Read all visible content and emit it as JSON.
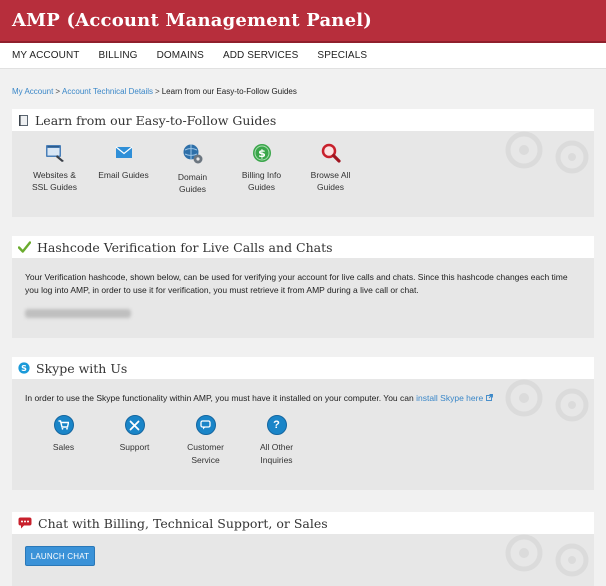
{
  "header": {
    "title": "AMP (Account Management Panel)"
  },
  "nav": {
    "items": [
      "MY ACCOUNT",
      "BILLING",
      "DOMAINS",
      "ADD SERVICES",
      "SPECIALS"
    ]
  },
  "breadcrumb": {
    "items": [
      "My Account",
      "Account Technical Details",
      "Learn from our Easy-to-Follow Guides"
    ],
    "separator": ">"
  },
  "guides": {
    "title": "Learn from our Easy-to-Follow Guides",
    "items": [
      {
        "label_1": "Websites &",
        "label_2": "SSL Guides",
        "icon": "website-ssl-icon"
      },
      {
        "label_1": "Email Guides",
        "label_2": "",
        "icon": "email-icon"
      },
      {
        "label_1": "Domain",
        "label_2": "Guides",
        "icon": "domain-gear-icon"
      },
      {
        "label_1": "Billing Info",
        "label_2": "Guides",
        "icon": "dollar-icon"
      },
      {
        "label_1": "Browse All",
        "label_2": "Guides",
        "icon": "magnifier-icon"
      }
    ]
  },
  "hashcode": {
    "title": "Hashcode Verification for Live Calls and Chats",
    "text": "Your Verification hashcode, shown below, can be used for verifying your account for live calls and chats. Since this hashcode changes each time you log into AMP, in order to use it for verification, you must retrieve it from AMP during a live call or chat."
  },
  "skype": {
    "title": "Skype with Us",
    "text": "In order to use the Skype functionality within AMP, you must have it installed on your computer. You can",
    "link": "install Skype here",
    "items": [
      {
        "label_1": "Sales",
        "label_2": "",
        "icon": "cart-icon"
      },
      {
        "label_1": "Support",
        "label_2": "",
        "icon": "tools-icon"
      },
      {
        "label_1": "Customer",
        "label_2": "Service",
        "icon": "chat-bubble-icon"
      },
      {
        "label_1": "All Other",
        "label_2": "Inquiries",
        "icon": "question-icon"
      }
    ]
  },
  "chat": {
    "title": "Chat with Billing, Technical Support, or Sales",
    "button": "LAUNCH CHAT"
  },
  "colors": {
    "brand": "#b72e3c",
    "link": "#3a87c8",
    "button": "#3a92d8"
  }
}
